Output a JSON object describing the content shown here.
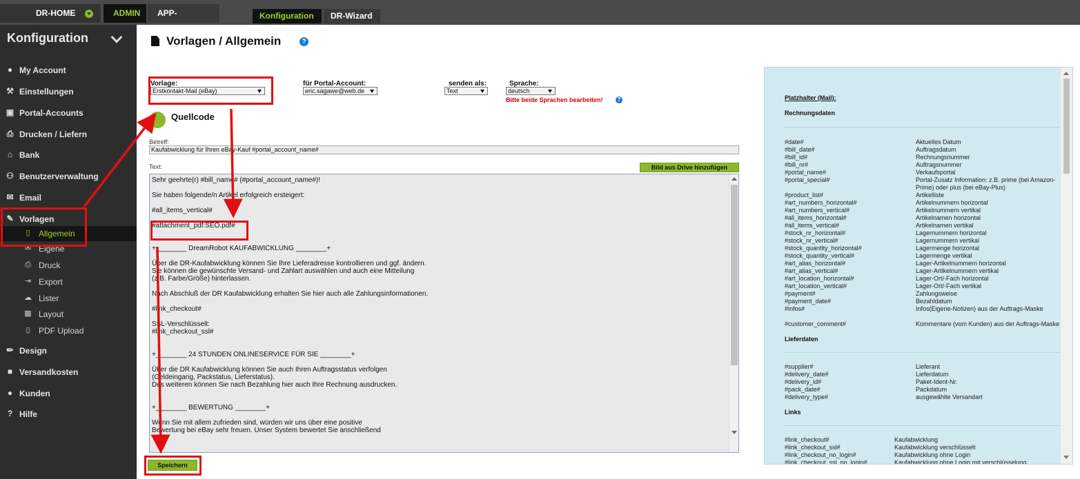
{
  "topbar": {
    "home": "DR-HOME",
    "admin": "ADMIN",
    "app_center": "APP-CENTER",
    "konfiguration": "Konfiguration",
    "wizard": "DR-Wizard"
  },
  "sidebar": {
    "title": "Konfiguration",
    "items": [
      {
        "label": "My Account",
        "icon": "user-circle-icon"
      },
      {
        "label": "Einstellungen",
        "icon": "wrench-icon"
      },
      {
        "label": "Portal-Accounts",
        "icon": "copy-icon"
      },
      {
        "label": "Drucken / Liefern",
        "icon": "printer-icon"
      },
      {
        "label": "Bank",
        "icon": "bank-icon"
      },
      {
        "label": "Benutzerverwaltung",
        "icon": "users-icon"
      },
      {
        "label": "Email",
        "icon": "envelope-icon"
      },
      {
        "label": "Vorlagen",
        "icon": "edit-icon"
      }
    ],
    "sub_items": [
      {
        "label": "Allgemein",
        "icon": "file-icon"
      },
      {
        "label": "Eigene",
        "icon": "envelope-icon"
      },
      {
        "label": "Druck",
        "icon": "printer-icon"
      },
      {
        "label": "Export",
        "icon": "export-icon"
      },
      {
        "label": "Lister",
        "icon": "cloud-upload-icon"
      },
      {
        "label": "Layout",
        "icon": "table-icon"
      },
      {
        "label": "PDF Upload",
        "icon": "file-pdf-icon"
      }
    ],
    "items_after": [
      {
        "label": "Design",
        "icon": "brush-icon"
      },
      {
        "label": "Versandkosten",
        "icon": "truck-icon"
      },
      {
        "label": "Kunden",
        "icon": "user-icon"
      },
      {
        "label": "Hilfe",
        "icon": "question-icon"
      }
    ]
  },
  "main": {
    "title": "Vorlagen / Allgemein",
    "vorlage_label": "Vorlage:",
    "vorlage_value": "Erstkontakt-Mail (eBay)",
    "portal_label": "für Portal-Account:",
    "portal_value": "eric.sagawe@web.de",
    "senden_label": "senden als:",
    "senden_value": "Text",
    "sprache_label": "Sprache:",
    "sprache_value": "deutsch",
    "warning": "Bitte beide Sprachen bearbeiten!",
    "quellcode": "Quellcode",
    "betreff_label": "Betreff:",
    "betreff_value": "Kaufabwicklung für Ihren eBay-Kauf #portal_account_name#",
    "text_label": "Text:",
    "bild_button": "Bild aus Drive hinzufügen",
    "save_button": "Speichern",
    "editor_lines": [
      "Sehr geehrte(r) #bill_name# (#portal_account_name#)!",
      "",
      "Sie haben folgende/n Artikel erfolgreich ersteigert:",
      "",
      "#all_items_vertical#",
      "",
      "#attachment_pdf:SEO.pdf#",
      "",
      "",
      "+________ DreamRobot KAUFABWICKLUNG ________+",
      "",
      "Über die DR-Kaufabwicklung können Sie Ihre Lieferadresse kontrollieren und ggf. ändern.",
      "Sie können die gewünschte Versand- und Zahlart auswählen und auch eine Mitteilung",
      "(z.B. Farbe/Größe) hinterlassen.",
      "",
      "Nach Abschluß der DR Kaufabwicklung erhalten Sie hier auch alle Zahlungsinformationen.",
      "",
      "#link_checkout#",
      "",
      "SSL-Verschlüsselt:",
      "#link_checkout_ssl#",
      "",
      "",
      "+________ 24 STUNDEN ONLINESERVICE FÜR SIE ________+",
      "",
      "Über die DR Kaufabwicklung können Sie auch Ihren Auftragsstatus verfolgen",
      "(Geldeingang, Packstatus, Lieferstatus).",
      "Des weiteren können Sie nach Bezahlung hier auch Ihre Rechnung ausdrucken.",
      "",
      "",
      "+________ BEWERTUNG ________+",
      "",
      "Wenn Sie mit allem zufrieden sind, würden wir uns über eine positive",
      "Bewertung bei eBay sehr freuen. Unser System bewertet Sie anschließend"
    ]
  },
  "placeholders": {
    "title": "Platzhalter (Mail):",
    "rechnung_heading": "Rechnungsdaten",
    "rechnung": [
      {
        "key": "#date#",
        "desc": "Aktuelles Datum"
      },
      {
        "key": "#bill_date#",
        "desc": "Auftragsdatum"
      },
      {
        "key": "#bill_id#",
        "desc": "Rechnungsnummer"
      },
      {
        "key": "#bill_nr#",
        "desc": "Auftragsnummer"
      },
      {
        "key": "#portal_name#",
        "desc": "Verkaufsportal"
      },
      {
        "key": "#portal_special#",
        "desc": "Portal-Zusatz Information: z.B. prime (bei Amazon-Prime) oder plus (bei eBay-Plus)"
      },
      {
        "key": "#product_list#",
        "desc": "Artikelliste"
      },
      {
        "key": "#art_numbers_horizontal#",
        "desc": "Artikelnummern horizontal"
      },
      {
        "key": "#art_numbers_vertical#",
        "desc": "Artikelnummern vertikal"
      },
      {
        "key": "#all_items_horizontal#",
        "desc": "Artikelnamen horizontal"
      },
      {
        "key": "#all_items_vertical#",
        "desc": "Artikelnamen vertikal"
      },
      {
        "key": "#stock_nr_horizontal#",
        "desc": "Lagernummern horizontal"
      },
      {
        "key": "#stock_nr_vertical#",
        "desc": "Lagernummern vertikal"
      },
      {
        "key": "#stock_quantity_horizontal#",
        "desc": "Lagermenge horizontal"
      },
      {
        "key": "#stock_quantity_vertical#",
        "desc": "Lagermenge vertikal"
      },
      {
        "key": "#art_alias_horizontal#",
        "desc": "Lager-Artikelnummern horizontal"
      },
      {
        "key": "#art_alias_vertical#",
        "desc": "Lager-Artikelnummern vertikal"
      },
      {
        "key": "#art_location_horizontal#",
        "desc": "Lager-Ort/-Fach horizontal"
      },
      {
        "key": "#art_location_vertical#",
        "desc": "Lager-Ort/-Fach vertikal"
      },
      {
        "key": "#payment#",
        "desc": "Zahlungsweise"
      },
      {
        "key": "#payment_date#",
        "desc": "Bezahldatum"
      },
      {
        "key": "#infos#",
        "desc": "Infos(Eigene-Notizen) aus der Auftrags-Maske"
      },
      {
        "key": "#customer_comment#",
        "desc": "Kommentare (vom Kunden) aus der Auftrags-Maske"
      }
    ],
    "liefer_heading": "Lieferdaten",
    "liefer": [
      {
        "key": "#supplier#",
        "desc": "Lieferant"
      },
      {
        "key": "#delivery_date#",
        "desc": "Lieferdatum"
      },
      {
        "key": "#delivery_id#",
        "desc": "Paket-Ident-Nr."
      },
      {
        "key": "#pack_date#",
        "desc": "Packdatum"
      },
      {
        "key": "#delivery_type#",
        "desc": "ausgewählte Versandart"
      }
    ],
    "links_heading": "Links",
    "links": [
      {
        "key": "#link_checkout#",
        "desc": "Kaufabwicklung"
      },
      {
        "key": "#link_checkout_ssl#",
        "desc": "Kaufabwicklung verschlüsselt"
      },
      {
        "key": "#link_checkout_no_login#",
        "desc": "Kaufabwicklung ohne Login"
      },
      {
        "key": "#link_checkout_ssl_no_login#",
        "desc": "Kaufabwicklung ohne Login mit verschlüsselung"
      }
    ]
  },
  "colors": {
    "accent_green": "#8cb82b",
    "annotation_red": "#e01010",
    "sidebar_bg": "#2d2d2d",
    "panel_bg": "#d2e9ef"
  }
}
